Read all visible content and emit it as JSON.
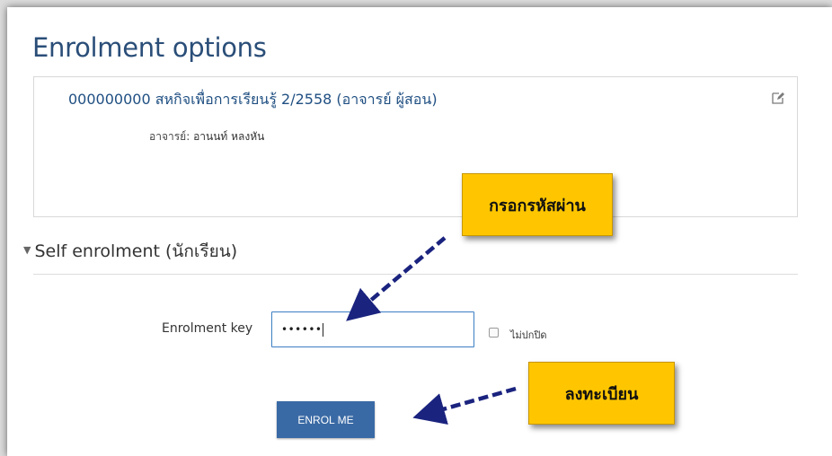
{
  "page": {
    "title": "Enrolment options"
  },
  "course": {
    "name": "000000000 สหกิจเพื่อการเรียนรู้ 2/2558 (อาจารย์ ผู้สอน)",
    "teacher_label": "อาจารย์:",
    "teacher_name": "อานนท์ หลงหัน",
    "edit_icon": "edit-icon"
  },
  "self_enrolment": {
    "heading": "Self enrolment (นักเรียน)",
    "key_label": "Enrolment key",
    "key_value": "••••••",
    "unmask_label": "ไม่ปกปิด",
    "unmask_checked": false,
    "button_label": "ENROL ME"
  },
  "annotations": {
    "callout_key": "กรอกรหัสผ่าน",
    "callout_enrol": "ลงทะเบียน"
  },
  "colors": {
    "title": "#2a4e78",
    "link": "#1f4f82",
    "button": "#3a6aa5",
    "callout": "#ffc600",
    "arrow": "#1a237e",
    "input_border": "#3c7ec4"
  }
}
